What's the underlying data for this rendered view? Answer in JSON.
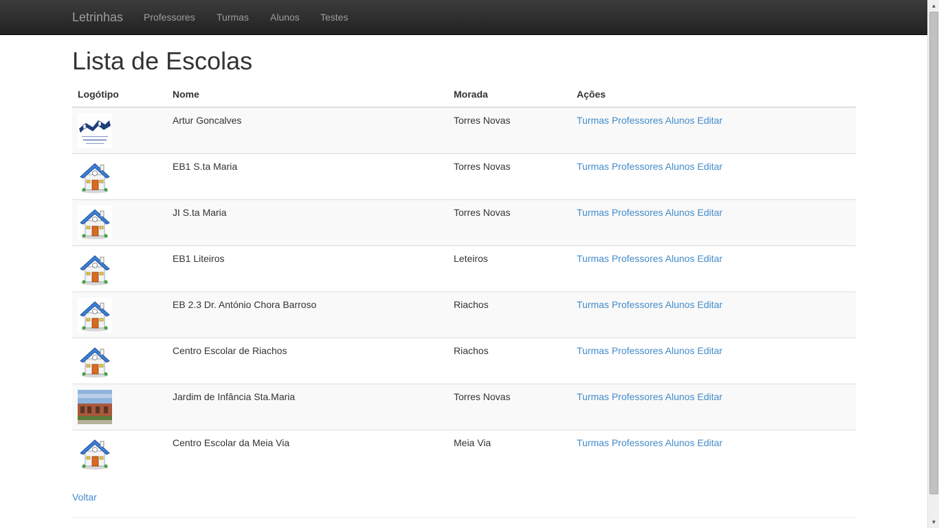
{
  "nav": {
    "brand": "Letrinhas",
    "items": [
      "Professores",
      "Turmas",
      "Alunos",
      "Testes"
    ]
  },
  "page_title": "Lista de Escolas",
  "table": {
    "headers": [
      "Logótipo",
      "Nome",
      "Morada",
      "Ações"
    ],
    "rows": [
      {
        "logo": "school-crest-logo",
        "nome": "Artur Goncalves",
        "morada": "Torres Novas",
        "logo_text": [
          "Agrupamento de Escolas",
          "Artur Gonçalves",
          "Torres Novas"
        ]
      },
      {
        "logo": "house-icon",
        "nome": "EB1 S.ta Maria",
        "morada": "Torres Novas"
      },
      {
        "logo": "house-icon",
        "nome": "JI S.ta Maria",
        "morada": "Torres Novas"
      },
      {
        "logo": "house-icon",
        "nome": "EB1 Liteiros",
        "morada": "Leteiros"
      },
      {
        "logo": "house-icon",
        "nome": "EB 2.3 Dr. António Chora Barroso",
        "morada": "Riachos"
      },
      {
        "logo": "house-icon",
        "nome": "Centro Escolar de Riachos",
        "morada": "Riachos"
      },
      {
        "logo": "building-photo",
        "nome": "Jardim de Infância Sta.Maria",
        "morada": "Torres Novas"
      },
      {
        "logo": "house-icon",
        "nome": "Centro Escolar da Meia Via",
        "morada": "Meia Via"
      }
    ],
    "actions": [
      "Turmas",
      "Professores",
      "Alunos",
      "Editar"
    ]
  },
  "back_label": "Voltar",
  "colors": {
    "navbar": "#222222",
    "nav_text": "#9d9d9d",
    "link": "#428bca",
    "stripe": "#f9f9f9",
    "border": "#dddddd"
  }
}
